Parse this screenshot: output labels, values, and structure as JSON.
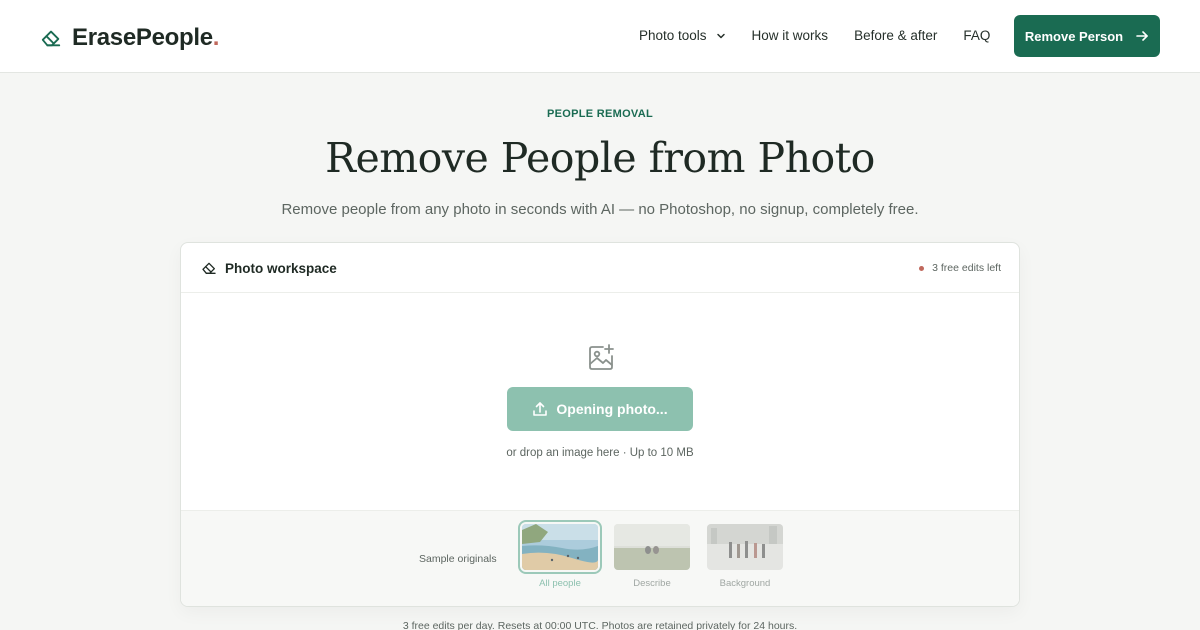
{
  "brand": {
    "name": "ErasePeople",
    "dot": ".",
    "accent": "#1a6b52",
    "dot_color": "#c0685c"
  },
  "nav": {
    "items": [
      {
        "label": "Photo tools",
        "has_dropdown": true
      },
      {
        "label": "How it works"
      },
      {
        "label": "Before & after"
      },
      {
        "label": "FAQ"
      }
    ],
    "cta": "Remove Person"
  },
  "hero": {
    "eyebrow": "PEOPLE REMOVAL",
    "title": "Remove People from Photo",
    "subtitle": "Remove people from any photo in seconds with AI — no Photoshop, no signup, completely free."
  },
  "workspace": {
    "title": "Photo workspace",
    "edits_left": "3 free edits left",
    "button": "Opening photo...",
    "drop_hint": "or drop an image here · Up to 10 MB",
    "samples_label": "Sample originals",
    "samples": [
      {
        "caption": "All people",
        "active": true,
        "icon": "beach-photo"
      },
      {
        "caption": "Describe",
        "active": false,
        "icon": "field-photo"
      },
      {
        "caption": "Background",
        "active": false,
        "icon": "street-photo"
      }
    ]
  },
  "footnote": "3 free edits per day. Resets at 00:00 UTC. Photos are retained privately for 24 hours."
}
